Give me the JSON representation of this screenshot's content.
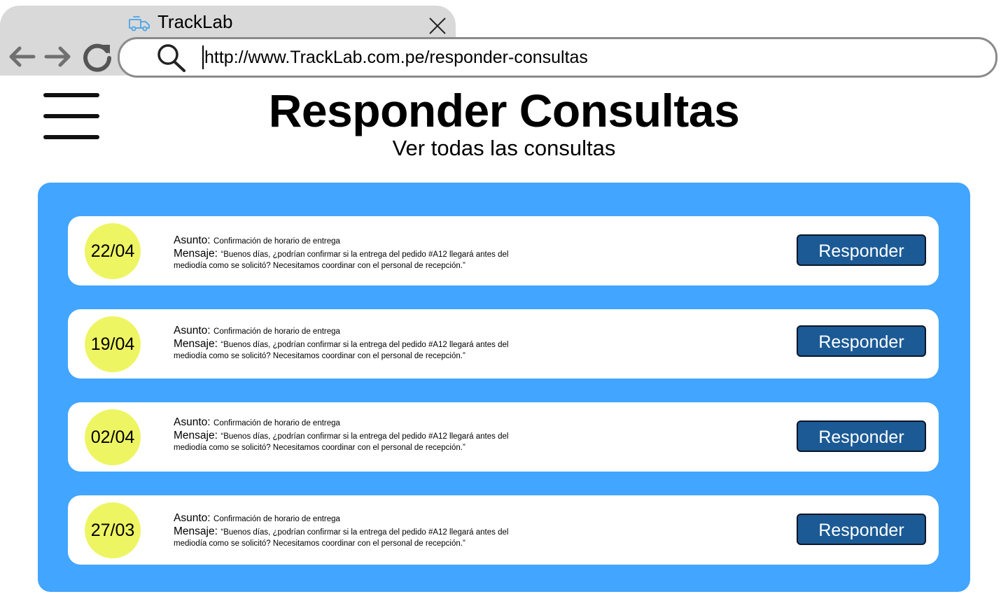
{
  "browser": {
    "tab_title": "TrackLab",
    "url": "http://www.TrackLab.com.pe/responder-consultas",
    "icons": {
      "tab": "delivery-truck-icon",
      "close": "close-icon",
      "back": "arrow-left-icon",
      "forward": "arrow-right-icon",
      "reload": "reload-icon",
      "search": "search-icon"
    }
  },
  "header": {
    "menu_icon": "hamburger-menu-icon",
    "title": "Responder Consultas",
    "subtitle": "Ver todas las consultas"
  },
  "colors": {
    "panel": "#42a5ff",
    "date_badge": "#eef562",
    "button": "#1b5a95",
    "tab": "#d9d9d9"
  },
  "labels": {
    "subject": "Asunto:",
    "message": "Mensaje:"
  },
  "consultas": [
    {
      "date": "22/04",
      "subject": "Confirmación de horario de entrega",
      "message_line1": "“Buenos días, ¿podrían confirmar si la entrega del pedido #A12 llegará antes del",
      "message_line2": "mediodía como se solicitó? Necesitamos coordinar con el personal de recepción.”",
      "button": "Responder"
    },
    {
      "date": "19/04",
      "subject": "Confirmación de horario de entrega",
      "message_line1": "“Buenos días, ¿podrían confirmar si la entrega del pedido #A12 llegará antes del",
      "message_line2": "mediodía como se solicitó? Necesitamos coordinar con el personal de recepción.”",
      "button": "Responder"
    },
    {
      "date": "02/04",
      "subject": "Confirmación de horario de entrega",
      "message_line1": "“Buenos días, ¿podrían confirmar si la entrega del pedido #A12 llegará antes del",
      "message_line2": "mediodía como se solicitó? Necesitamos coordinar con el personal de recepción.”",
      "button": "Responder"
    },
    {
      "date": "27/03",
      "subject": "Confirmación de horario de entrega",
      "message_line1": "“Buenos días, ¿podrían confirmar si la entrega del pedido #A12 llegará antes del",
      "message_line2": "mediodía como se solicitó? Necesitamos coordinar con el personal de recepción.”",
      "button": "Responder"
    }
  ]
}
